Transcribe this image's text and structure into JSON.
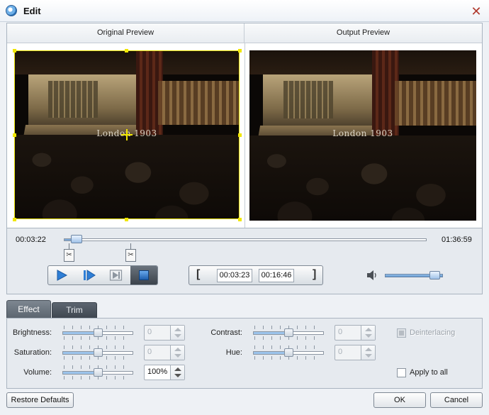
{
  "window": {
    "title": "Edit"
  },
  "preview": {
    "original_label": "Original Preview",
    "output_label": "Output Preview",
    "caption_text": "London 1903"
  },
  "playback": {
    "current_time": "00:03:22",
    "total_time": "01:36:59",
    "progress": 0.035,
    "clip_start": "00:03:23",
    "clip_end": "00:16:46",
    "volume_level": 0.85
  },
  "tabs": {
    "effect": "Effect",
    "trim": "Trim"
  },
  "effect": {
    "brightness": {
      "label": "Brightness:",
      "value": "0",
      "level": 0.5
    },
    "contrast": {
      "label": "Contrast:",
      "value": "0",
      "level": 0.5
    },
    "saturation": {
      "label": "Saturation:",
      "value": "0",
      "level": 0.5
    },
    "hue": {
      "label": "Hue:",
      "value": "0",
      "level": 0.5
    },
    "volume": {
      "label": "Volume:",
      "value": "100%",
      "level": 0.5
    },
    "deinterlacing_label": "Deinterlacing",
    "apply_all_label": "Apply to all"
  },
  "buttons": {
    "restore_defaults": "Restore Defaults",
    "ok": "OK",
    "cancel": "Cancel"
  },
  "colors": {
    "crop_handle": "#f0e600",
    "accent_blue": "#2a6fb5",
    "tab_active": "#6b747e"
  }
}
